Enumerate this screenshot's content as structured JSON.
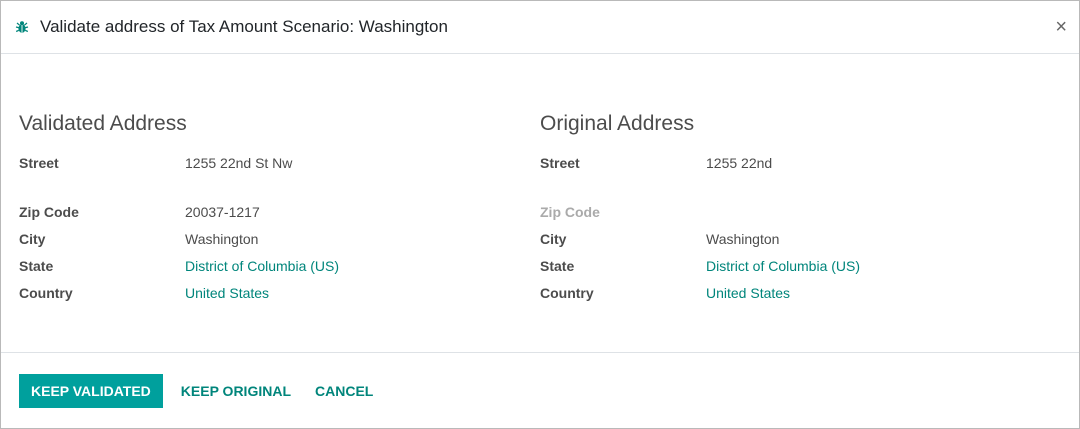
{
  "dialog": {
    "title": "Validate address of Tax Amount Scenario: Washington",
    "close_glyph": "×",
    "icon": "bug-icon",
    "accent_color": "#00a09d",
    "link_color": "#00857b"
  },
  "validated": {
    "heading": "Validated Address",
    "street_label": "Street",
    "street": "1255 22nd St Nw",
    "zip_label": "Zip Code",
    "zip": "20037-1217",
    "city_label": "City",
    "city": "Washington",
    "state_label": "State",
    "state": "District of Columbia (US)",
    "country_label": "Country",
    "country": "United States"
  },
  "original": {
    "heading": "Original Address",
    "street_label": "Street",
    "street": "1255 22nd",
    "zip_label": "Zip Code",
    "zip": "",
    "city_label": "City",
    "city": "Washington",
    "state_label": "State",
    "state": "District of Columbia (US)",
    "country_label": "Country",
    "country": "United States"
  },
  "footer": {
    "keep_validated": "KEEP VALIDATED",
    "keep_original": "KEEP ORIGINAL",
    "cancel": "CANCEL"
  }
}
